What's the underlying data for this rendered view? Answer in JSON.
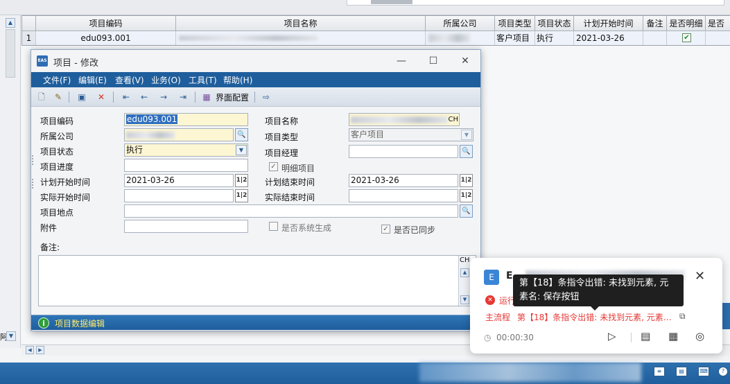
{
  "grid": {
    "headers": [
      "项目编码",
      "项目名称",
      "所属公司",
      "项目类型",
      "项目状态",
      "计划开始时间",
      "备注",
      "是否明细",
      "是否"
    ],
    "row": {
      "num": "1",
      "code": "edu093.001",
      "type": "客户项目",
      "status": "执行",
      "plan_start": "2021-03-26",
      "is_detail": "✔"
    }
  },
  "dialog": {
    "title": "项目 - 修改",
    "logo": "EAS",
    "menu": [
      "文件(F)",
      "编辑(E)",
      "查看(V)",
      "业务(O)",
      "工具(T)",
      "帮助(H)"
    ],
    "toolbar_ui_label": "界面配置",
    "toolbar_icons": [
      "new-icon",
      "edit-icon",
      "save-icon",
      "delete-icon",
      "first-icon",
      "prev-icon",
      "next-icon",
      "last-icon",
      "ui-config-icon",
      "exit-icon"
    ],
    "fields": {
      "code_label": "项目编码",
      "code_value": "edu093.001",
      "name_label": "项目名称",
      "name_suffix": "CH",
      "company_label": "所属公司",
      "type_label": "项目类型",
      "type_value": "客户项目",
      "status_label": "项目状态",
      "status_value": "执行",
      "manager_label": "项目经理",
      "progress_label": "项目进度",
      "detail_label": "明细项目",
      "plan_start_label": "计划开始时间",
      "plan_start_value": "2021-03-26",
      "plan_end_label": "计划结束时间",
      "plan_end_value": "2021-03-26",
      "actual_start_label": "实际开始时间",
      "actual_end_label": "实际结束时间",
      "location_label": "项目地点",
      "attachment_label": "附件",
      "system_gen_label": "是否系统生成",
      "synced_label": "是否已同步",
      "remarks_label": "备注:",
      "remarks_suffix": "CH",
      "date_btn": "1|2"
    },
    "status_text": "项目数据编辑"
  },
  "notification": {
    "logo": "E",
    "title": "E",
    "run_label": "运行",
    "flow_tag": "主流程",
    "message": "第【18】条指令出错: 未找到元素, 元素名: 保存按钮",
    "time": "00:00:30"
  },
  "tooltip": {
    "text": "第【18】条指令出错: 未找到元素, 元素名: 保存按钮"
  },
  "bg": {
    "left_text": "阿"
  }
}
